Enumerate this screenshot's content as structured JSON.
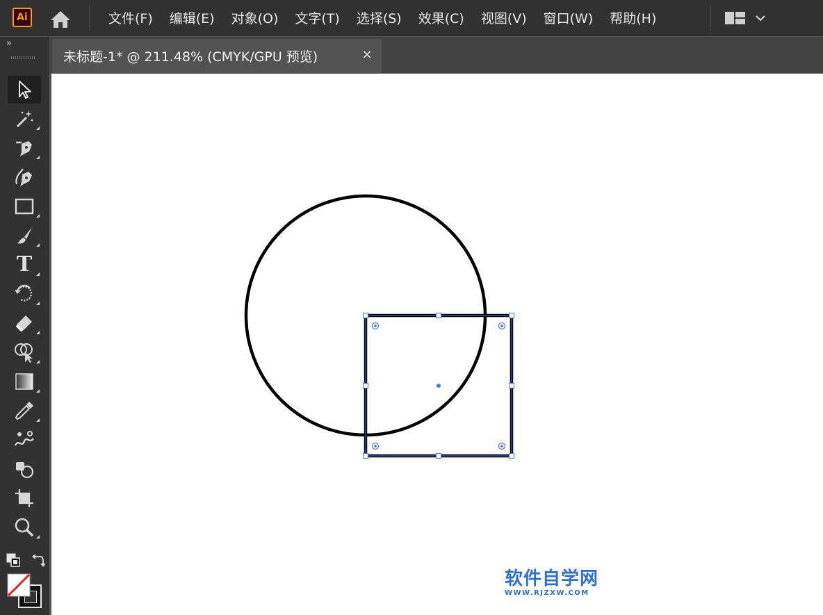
{
  "app": {
    "logo_text": "Ai",
    "logo_color": "#ff9a00"
  },
  "menu": {
    "items": [
      "文件(F)",
      "编辑(E)",
      "对象(O)",
      "文字(T)",
      "选择(S)",
      "效果(C)",
      "视图(V)",
      "窗口(W)",
      "帮助(H)"
    ]
  },
  "document": {
    "tab_title": "未标题-1* @ 211.48% (CMYK/GPU 预览)",
    "close_glyph": "×"
  },
  "toolbar": {
    "collapse_glyph": "»",
    "type_tool_glyph": "T",
    "tools": [
      "selection-tool",
      "magic-wand-tool",
      "pen-tool",
      "curvature-tool",
      "rectangle-tool",
      "paintbrush-tool",
      "type-tool",
      "rotate-tool",
      "eraser-tool",
      "shape-builder-tool",
      "gradient-tool",
      "eyedropper-tool",
      "blend-tool",
      "symbol-sprayer-tool",
      "artboard-tool",
      "zoom-tool"
    ],
    "active_tool": "selection-tool",
    "fill": "none",
    "stroke": "#000000"
  },
  "selection": {
    "color": "#1f3ed6",
    "handle_color": "#4a79d8"
  },
  "watermark": {
    "text": "软件自学网",
    "url": "WWW.RJZXW.COM",
    "color": "#2e6fd0"
  }
}
